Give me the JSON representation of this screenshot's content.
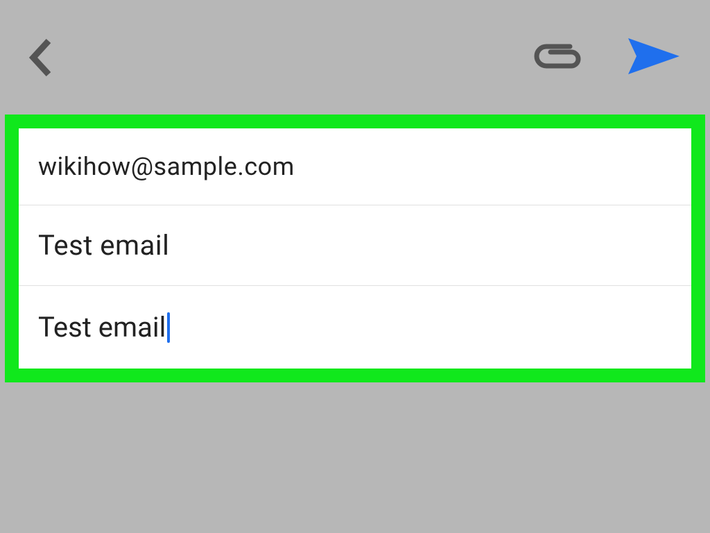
{
  "toolbar": {
    "back_name": "back",
    "attach_name": "attach",
    "send_name": "send"
  },
  "compose": {
    "to": "wikihow@sample.com",
    "subject": "Test email",
    "body": "Test email"
  },
  "colors": {
    "highlight": "#10e81c",
    "send": "#1f6fed",
    "icon": "#545454",
    "background": "#b7b7b7"
  }
}
